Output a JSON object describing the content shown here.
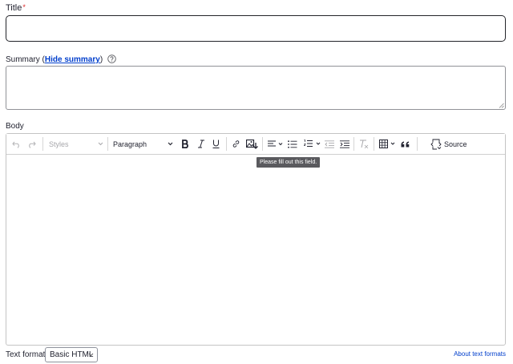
{
  "title_field": {
    "label": "Title",
    "required_mark": "*",
    "value": ""
  },
  "summary_field": {
    "label_prefix": "Summary (",
    "toggle_link": "Hide summary",
    "label_suffix": ")",
    "value": ""
  },
  "body_field": {
    "label": "Body",
    "toolbar": {
      "undo_icon": "undo-icon",
      "redo_icon": "redo-icon",
      "styles_label": "Styles",
      "heading_label": "Paragraph",
      "source_label": "Source"
    },
    "tooltip": "Please fill out this field."
  },
  "text_format": {
    "label": "Text format",
    "selected": "Basic HTML",
    "about_link": "About text formats"
  },
  "colors": {
    "link": "#003ecc",
    "required": "#dc2323",
    "focus_border": "#232429"
  }
}
